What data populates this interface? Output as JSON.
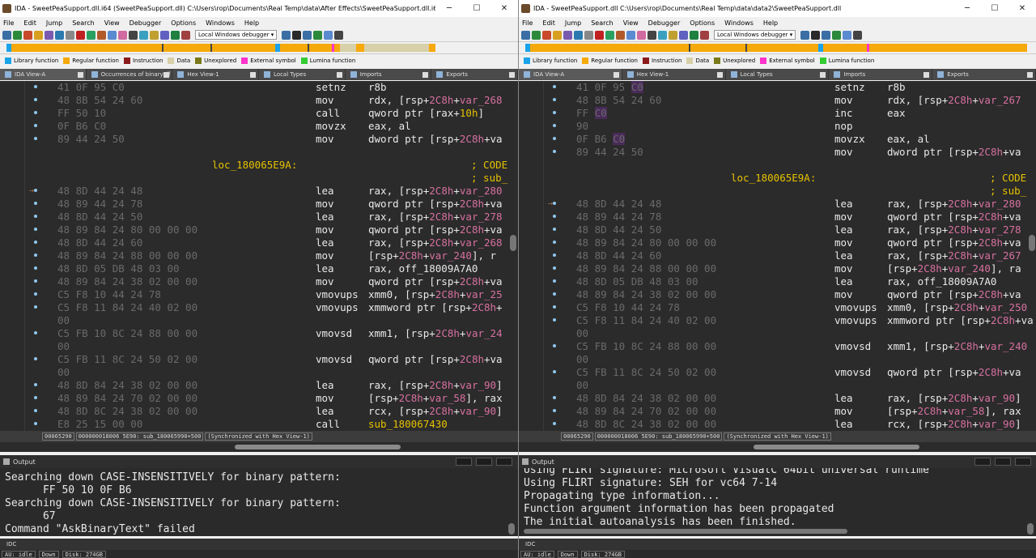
{
  "left": {
    "title": "IDA - SweetPeaSupport.dll.i64 (SweetPeaSupport.dll) C:\\Users\\rop\\Documents\\Real Temp\\data\\After Effects\\SweetPeaSupport.dll.i64",
    "tabs": [
      "IDA View-A",
      "Occurrences of binary: ff 50 10 0f b6",
      "Hex View-1",
      "Local Types",
      "Imports",
      "Exports"
    ],
    "status_fields": [
      "00065290",
      "000000018006 5E90: sub_180065990+500",
      "(Synchronized with Hex View-1)"
    ],
    "lines": [
      {
        "bytes": "41 0F 95 C0",
        "mn": "setnz",
        "op": [
          [
            "r8b",
            ""
          ]
        ]
      },
      {
        "bytes": "48 8B 54 24 60",
        "mn": "mov",
        "op": [
          [
            "rdx, [rsp+",
            ""
          ],
          [
            "2C8h",
            "p"
          ],
          [
            "+",
            ""
          ],
          [
            "var_268",
            "p"
          ]
        ]
      },
      {
        "bytes": "FF 50 10",
        "mn": "call",
        "op": [
          [
            "qword ptr [rax+",
            ""
          ],
          [
            "10h",
            "y"
          ],
          [
            "]",
            ""
          ]
        ]
      },
      {
        "bytes": "0F B6 C0",
        "mn": "movzx",
        "op": [
          [
            "eax, al",
            ""
          ]
        ]
      },
      {
        "bytes": "89 44 24 50",
        "mn": "mov",
        "op": [
          [
            "dword ptr [rsp+",
            ""
          ],
          [
            "2C8h",
            "p"
          ],
          [
            "+va",
            ""
          ]
        ]
      },
      {
        "bytes": "",
        "mn": "",
        "op": []
      },
      {
        "label": "loc_180065E9A:",
        "cmt": "; CODE"
      },
      {
        "cmt": "; sub_"
      },
      {
        "bytes": "48 8D 44 24 48",
        "mn": "lea",
        "op": [
          [
            "rax, [rsp+",
            ""
          ],
          [
            "2C8h",
            "p"
          ],
          [
            "+",
            ""
          ],
          [
            "var_280",
            "p"
          ]
        ],
        "arrow": true
      },
      {
        "bytes": "48 89 44 24 78",
        "mn": "mov",
        "op": [
          [
            "qword ptr [rsp+",
            ""
          ],
          [
            "2C8h",
            "p"
          ],
          [
            "+va",
            ""
          ]
        ]
      },
      {
        "bytes": "48 8D 44 24 50",
        "mn": "lea",
        "op": [
          [
            "rax, [rsp+",
            ""
          ],
          [
            "2C8h",
            "p"
          ],
          [
            "+",
            ""
          ],
          [
            "var_278",
            "p"
          ]
        ]
      },
      {
        "bytes": "48 89 84 24 80 00 00 00",
        "mn": "mov",
        "op": [
          [
            "qword ptr [rsp+",
            ""
          ],
          [
            "2C8h",
            "p"
          ],
          [
            "+va",
            ""
          ]
        ]
      },
      {
        "bytes": "48 8D 44 24 60",
        "mn": "lea",
        "op": [
          [
            "rax, [rsp+",
            ""
          ],
          [
            "2C8h",
            "p"
          ],
          [
            "+",
            ""
          ],
          [
            "var_268",
            "p"
          ]
        ]
      },
      {
        "bytes": "48 89 84 24 88 00 00 00",
        "mn": "mov",
        "op": [
          [
            "[rsp+",
            ""
          ],
          [
            "2C8h",
            "p"
          ],
          [
            "+",
            ""
          ],
          [
            "var_240",
            "p"
          ],
          [
            "], r",
            ""
          ]
        ]
      },
      {
        "bytes": "48 8D 05 DB 48 03 00",
        "mn": "lea",
        "op": [
          [
            "rax, off_18009A7A0",
            ""
          ]
        ]
      },
      {
        "bytes": "48 89 84 24 38 02 00 00",
        "mn": "mov",
        "op": [
          [
            "qword ptr [rsp+",
            ""
          ],
          [
            "2C8h",
            "p"
          ],
          [
            "+va",
            ""
          ]
        ]
      },
      {
        "bytes": "C5 F8 10 44 24 78",
        "mn": "vmovups",
        "op": [
          [
            "xmm0, [rsp+",
            ""
          ],
          [
            "2C8h",
            "p"
          ],
          [
            "+",
            ""
          ],
          [
            "var_25",
            "p"
          ]
        ]
      },
      {
        "bytes": "C5 F8 11 84 24 40 02 00",
        "mn": "vmovups",
        "op": [
          [
            "xmmword ptr [rsp+",
            ""
          ],
          [
            "2C8h",
            "p"
          ],
          [
            "+",
            ""
          ]
        ]
      },
      {
        "bytes": "00",
        "mn": "",
        "op": []
      },
      {
        "bytes": "C5 FB 10 8C 24 88 00 00",
        "mn": "vmovsd",
        "op": [
          [
            "xmm1, [rsp+",
            ""
          ],
          [
            "2C8h",
            "p"
          ],
          [
            "+",
            ""
          ],
          [
            "var_24",
            "p"
          ]
        ]
      },
      {
        "bytes": "00",
        "mn": "",
        "op": []
      },
      {
        "bytes": "C5 FB 11 8C 24 50 02 00",
        "mn": "vmovsd",
        "op": [
          [
            "qword ptr [rsp+",
            ""
          ],
          [
            "2C8h",
            "p"
          ],
          [
            "+va",
            ""
          ]
        ]
      },
      {
        "bytes": "00",
        "mn": "",
        "op": []
      },
      {
        "bytes": "48 8D 84 24 38 02 00 00",
        "mn": "lea",
        "op": [
          [
            "rax, [rsp+",
            ""
          ],
          [
            "2C8h",
            "p"
          ],
          [
            "+",
            ""
          ],
          [
            "var_90",
            "p"
          ],
          [
            "]",
            ""
          ]
        ]
      },
      {
        "bytes": "48 89 84 24 70 02 00 00",
        "mn": "mov",
        "op": [
          [
            "[rsp+",
            ""
          ],
          [
            "2C8h",
            "p"
          ],
          [
            "+",
            ""
          ],
          [
            "var_58",
            "p"
          ],
          [
            "], rax",
            ""
          ]
        ]
      },
      {
        "bytes": "48 8D 8C 24 38 02 00 00",
        "mn": "lea",
        "op": [
          [
            "rcx, [rsp+",
            ""
          ],
          [
            "2C8h",
            "p"
          ],
          [
            "+",
            ""
          ],
          [
            "var_90",
            "p"
          ],
          [
            "]",
            ""
          ]
        ]
      },
      {
        "bytes": "E8 25 15 00 00",
        "mn": "call",
        "op": [
          [
            "sub_180067430",
            "y"
          ]
        ]
      }
    ],
    "output": [
      "Searching down CASE-INSENSITIVELY for binary pattern:",
      "      FF 50 10 0F B6",
      "Searching down CASE-INSENSITIVELY for binary pattern:",
      "      67",
      "Command \"AskBinaryText\" failed"
    ]
  },
  "right": {
    "title": "IDA - SweetPeaSupport.dll C:\\Users\\rop\\Documents\\Real Temp\\data\\data2\\SweetPeaSupport.dll",
    "tabs": [
      "IDA View-A",
      "Hex View-1",
      "Local Types",
      "Imports",
      "Exports"
    ],
    "status_fields": [
      "00065290",
      "000000018006 5E90: sub_180065990+500",
      "(Synchronized with Hex View-1)"
    ],
    "lines": [
      {
        "bytes": "41 0F 95 C0",
        "hlLast": true,
        "mn": "setnz",
        "op": [
          [
            "r8b",
            ""
          ]
        ]
      },
      {
        "bytes": "48 8B 54 24 60",
        "mn": "mov",
        "op": [
          [
            "rdx, [rsp+",
            ""
          ],
          [
            "2C8h",
            "p"
          ],
          [
            "+",
            ""
          ],
          [
            "var_267",
            "p"
          ]
        ]
      },
      {
        "bytes": "FF C0",
        "hlLast": true,
        "mn": "inc",
        "op": [
          [
            "eax",
            ""
          ]
        ]
      },
      {
        "bytes": "90",
        "mn": "nop",
        "op": []
      },
      {
        "bytes": "0F B6 C0",
        "hlLast": true,
        "mn": "movzx",
        "op": [
          [
            "eax, al",
            ""
          ]
        ]
      },
      {
        "bytes": "89 44 24 50",
        "mn": "mov",
        "op": [
          [
            "dword ptr [rsp+",
            ""
          ],
          [
            "2C8h",
            "p"
          ],
          [
            "+va",
            ""
          ]
        ]
      },
      {
        "bytes": "",
        "mn": "",
        "op": []
      },
      {
        "label": "loc_180065E9A:",
        "cmt": "; CODE"
      },
      {
        "cmt": "; sub_"
      },
      {
        "bytes": "48 8D 44 24 48",
        "mn": "lea",
        "op": [
          [
            "rax, [rsp+",
            ""
          ],
          [
            "2C8h",
            "p"
          ],
          [
            "+",
            ""
          ],
          [
            "var_280",
            "p"
          ]
        ],
        "arrow": true
      },
      {
        "bytes": "48 89 44 24 78",
        "mn": "mov",
        "op": [
          [
            "qword ptr [rsp+",
            ""
          ],
          [
            "2C8h",
            "p"
          ],
          [
            "+va",
            ""
          ]
        ]
      },
      {
        "bytes": "48 8D 44 24 50",
        "mn": "lea",
        "op": [
          [
            "rax, [rsp+",
            ""
          ],
          [
            "2C8h",
            "p"
          ],
          [
            "+",
            ""
          ],
          [
            "var_278",
            "p"
          ]
        ]
      },
      {
        "bytes": "48 89 84 24 80 00 00 00",
        "mn": "mov",
        "op": [
          [
            "qword ptr [rsp+",
            ""
          ],
          [
            "2C8h",
            "p"
          ],
          [
            "+va",
            ""
          ]
        ]
      },
      {
        "bytes": "48 8D 44 24 60",
        "mn": "lea",
        "op": [
          [
            "rax, [rsp+",
            ""
          ],
          [
            "2C8h",
            "p"
          ],
          [
            "+",
            ""
          ],
          [
            "var_267",
            "p"
          ]
        ]
      },
      {
        "bytes": "48 89 84 24 88 00 00 00",
        "mn": "mov",
        "op": [
          [
            "[rsp+",
            ""
          ],
          [
            "2C8h",
            "p"
          ],
          [
            "+",
            ""
          ],
          [
            "var_240",
            "p"
          ],
          [
            "], ra",
            ""
          ]
        ]
      },
      {
        "bytes": "48 8D 05 DB 48 03 00",
        "mn": "lea",
        "op": [
          [
            "rax, off_18009A7A0",
            ""
          ]
        ]
      },
      {
        "bytes": "48 89 84 24 38 02 00 00",
        "mn": "mov",
        "op": [
          [
            "qword ptr [rsp+",
            ""
          ],
          [
            "2C8h",
            "p"
          ],
          [
            "+va",
            ""
          ]
        ]
      },
      {
        "bytes": "C5 F8 10 44 24 78",
        "mn": "vmovups",
        "op": [
          [
            "xmm0, [rsp+",
            ""
          ],
          [
            "2C8h",
            "p"
          ],
          [
            "+",
            ""
          ],
          [
            "var_250",
            "p"
          ]
        ]
      },
      {
        "bytes": "C5 F8 11 84 24 40 02 00",
        "mn": "vmovups",
        "op": [
          [
            "xmmword ptr [rsp+",
            ""
          ],
          [
            "2C8h",
            "p"
          ],
          [
            "+va",
            ""
          ]
        ]
      },
      {
        "bytes": "00",
        "mn": "",
        "op": []
      },
      {
        "bytes": "C5 FB 10 8C 24 88 00 00",
        "mn": "vmovsd",
        "op": [
          [
            "xmm1, [rsp+",
            ""
          ],
          [
            "2C8h",
            "p"
          ],
          [
            "+",
            ""
          ],
          [
            "var_240",
            "p"
          ]
        ]
      },
      {
        "bytes": "00",
        "mn": "",
        "op": []
      },
      {
        "bytes": "C5 FB 11 8C 24 50 02 00",
        "mn": "vmovsd",
        "op": [
          [
            "qword ptr [rsp+",
            ""
          ],
          [
            "2C8h",
            "p"
          ],
          [
            "+va",
            ""
          ]
        ]
      },
      {
        "bytes": "00",
        "mn": "",
        "op": []
      },
      {
        "bytes": "48 8D 84 24 38 02 00 00",
        "mn": "lea",
        "op": [
          [
            "rax, [rsp+",
            ""
          ],
          [
            "2C8h",
            "p"
          ],
          [
            "+",
            ""
          ],
          [
            "var_90",
            "p"
          ],
          [
            "]",
            ""
          ]
        ]
      },
      {
        "bytes": "48 89 84 24 70 02 00 00",
        "mn": "mov",
        "op": [
          [
            "[rsp+",
            ""
          ],
          [
            "2C8h",
            "p"
          ],
          [
            "+",
            ""
          ],
          [
            "var_58",
            "p"
          ],
          [
            "], rax",
            ""
          ]
        ]
      },
      {
        "bytes": "48 8D 8C 24 38 02 00 00",
        "mn": "lea",
        "op": [
          [
            "rcx, [rsp+",
            ""
          ],
          [
            "2C8h",
            "p"
          ],
          [
            "+",
            ""
          ],
          [
            "var_90",
            "p"
          ],
          [
            "]",
            ""
          ]
        ]
      }
    ],
    "output": [
      "Using FLIRT signature: Microsoft VisualC 64bit universal runtime",
      "Using FLIRT signature: SEH for vc64 7-14",
      "Propagating type information...",
      "Function argument information has been propagated",
      "The initial autoanalysis has been finished."
    ]
  },
  "common": {
    "menu": [
      "File",
      "Edit",
      "Jump",
      "Search",
      "View",
      "Debugger",
      "Options",
      "Windows",
      "Help"
    ],
    "debugger_select": "Local Windows debugger",
    "legend": [
      {
        "label": "Library function",
        "color": "#1aa3e8"
      },
      {
        "label": "Regular function",
        "color": "#f6a90a"
      },
      {
        "label": "Instruction",
        "color": "#8b1a1a"
      },
      {
        "label": "Data",
        "color": "#d8d0a8"
      },
      {
        "label": "Unexplored",
        "color": "#7a7a1a"
      },
      {
        "label": "External symbol",
        "color": "#ff33cc"
      },
      {
        "label": "Lumina function",
        "color": "#33cc33"
      }
    ],
    "output_title": "Output",
    "idc_label": "IDC",
    "au_status": "AU:  idle",
    "down_status": "Down",
    "disk_status": "Disk: 274GB",
    "window_controls": [
      "─",
      "☐",
      "✕"
    ]
  }
}
